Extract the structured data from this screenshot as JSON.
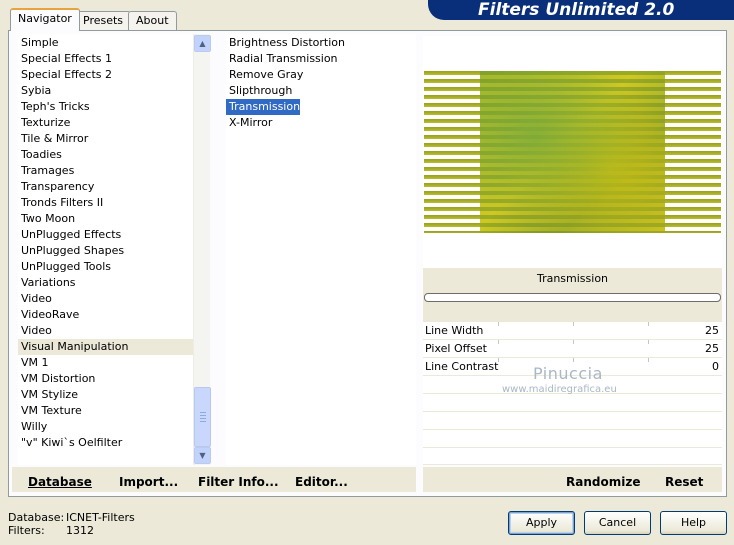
{
  "window": {
    "title": "Filters Unlimited 2.0"
  },
  "tabs": [
    {
      "label": "Navigator",
      "active": true
    },
    {
      "label": "Presets",
      "active": false
    },
    {
      "label": "About",
      "active": false
    }
  ],
  "categories": {
    "items": [
      "Simple",
      "Special Effects 1",
      "Special Effects 2",
      "Sybia",
      "Teph's Tricks",
      "Texturize",
      "Tile & Mirror",
      "Toadies",
      "Tramages",
      "Transparency",
      "Tronds Filters II",
      "Two Moon",
      "UnPlugged Effects",
      "UnPlugged Shapes",
      "UnPlugged Tools",
      "Variations",
      "Video",
      "VideoRave",
      "Video",
      "Visual Manipulation",
      "VM 1",
      "VM Distortion",
      "VM Stylize",
      "VM Texture",
      "Willy",
      "\"v\" Kiwi`s Oelfilter"
    ],
    "highlighted": "Visual Manipulation"
  },
  "filters": {
    "items": [
      "Brightness Distortion",
      "Radial Transmission",
      "Remove Gray",
      "Slipthrough",
      "Transmission",
      "X-Mirror"
    ],
    "selected": "Transmission"
  },
  "preview": {
    "filter_name": "Transmission",
    "progress": 0
  },
  "params": [
    {
      "label": "Line Width",
      "value": "25"
    },
    {
      "label": "Pixel Offset",
      "value": "25"
    },
    {
      "label": "Line Contrast",
      "value": "0"
    }
  ],
  "watermark": {
    "name": "Pinuccia",
    "url": "www.maidiregrafica.eu"
  },
  "toolbar": {
    "database": "Database",
    "import": "Import...",
    "filter_info": "Filter Info...",
    "editor": "Editor...",
    "randomize": "Randomize",
    "reset": "Reset"
  },
  "status": {
    "database_label": "Database:",
    "database_value": "ICNET-Filters",
    "filters_label": "Filters:",
    "filters_value": "1312"
  },
  "buttons": {
    "apply": "Apply",
    "cancel": "Cancel",
    "help": "Help"
  },
  "colors": {
    "banner": "#0a2f7a",
    "selection": "#316ac5",
    "dialog_bg": "#ece9d8"
  }
}
